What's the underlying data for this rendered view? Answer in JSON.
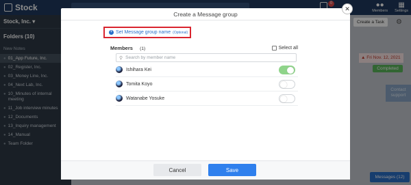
{
  "app": {
    "name": "Stock",
    "org": "Stock, Inc.",
    "folders_label": "Folders",
    "folders_count": "(10)",
    "new_notes": "New Notes",
    "folders": [
      {
        "label": "01_App Future, Inc.",
        "active": true
      },
      {
        "label": "02_Register, Inc."
      },
      {
        "label": "03_Money Line, Inc."
      },
      {
        "label": "04_Next Lab, Inc."
      },
      {
        "label": "10_Minutes of internal meeting"
      },
      {
        "label": "11_Job interview minutes"
      },
      {
        "label": "12_Documents"
      },
      {
        "label": "13_Inquiry management"
      },
      {
        "label": "14_Manual"
      },
      {
        "label": "Team Folder"
      }
    ],
    "top": {
      "members_label": "Members",
      "settings_label": "Settings",
      "badge": "0"
    },
    "create_task": "Create a Task",
    "date_card": "Fri Nov. 12, 2021",
    "completed": "Completed",
    "contact": "Contact support",
    "messages": "Messages (12)"
  },
  "modal": {
    "title": "Create a Message group",
    "set_name": "Set Message group name",
    "optional": "(Optional)",
    "members_label": "Members",
    "members_count": "(1)",
    "select_all": "Select all",
    "search_placeholder": "Search by member name",
    "members": [
      {
        "name": "Ishihara Kei",
        "on": true
      },
      {
        "name": "Tomita Koyo",
        "on": false
      },
      {
        "name": "Watanabe Yosuke",
        "on": false
      }
    ],
    "cancel": "Cancel",
    "save": "Save"
  },
  "colors": {
    "primary": "#2f80ed",
    "highlight": "#d9232e",
    "toggle_on": "#8fd48a"
  }
}
